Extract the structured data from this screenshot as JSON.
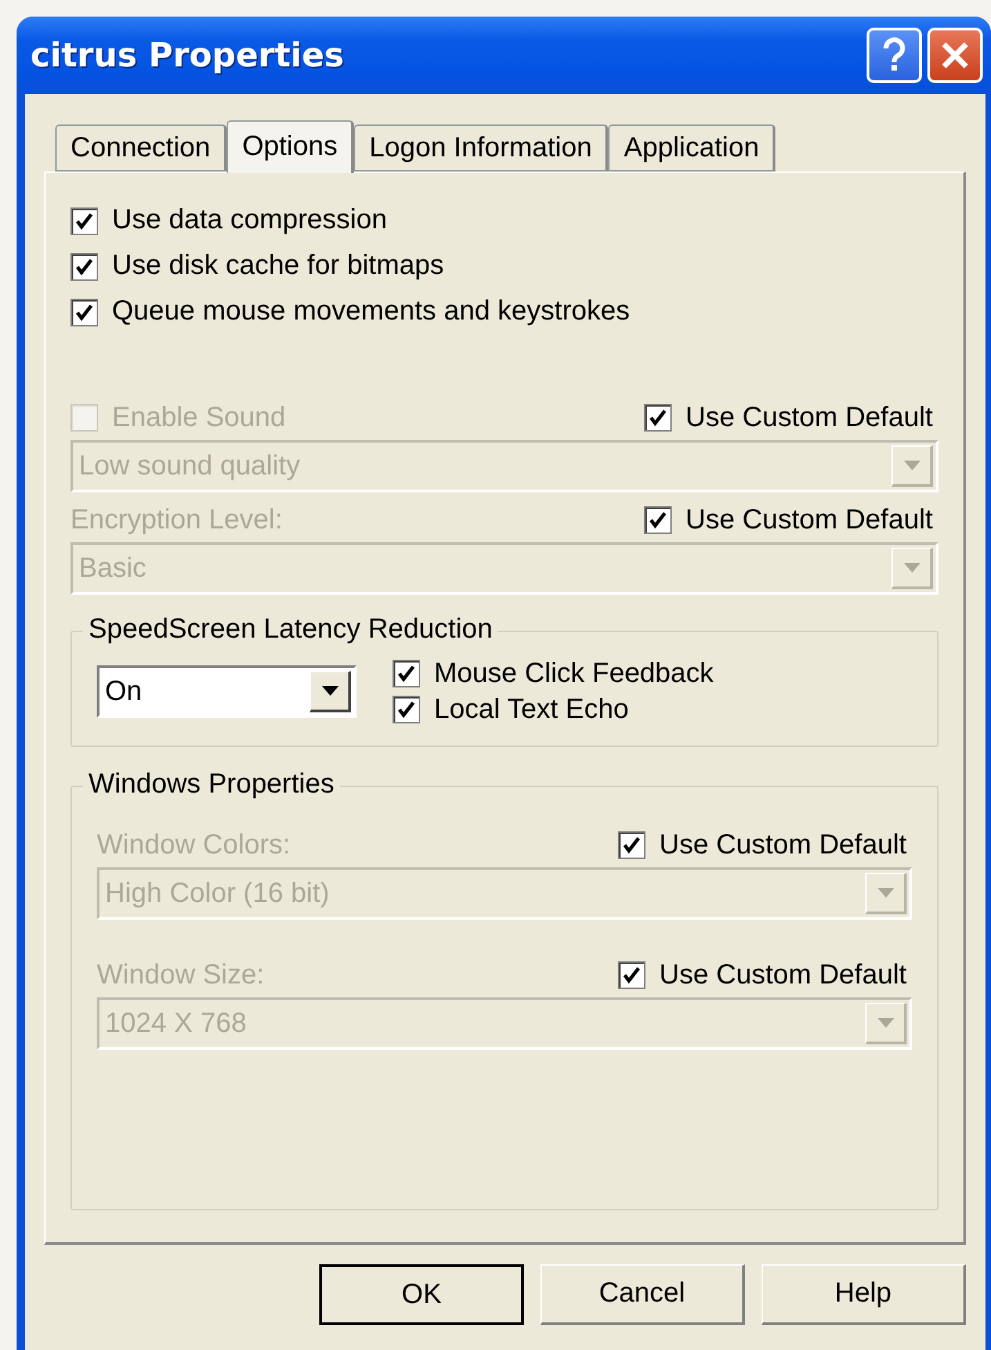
{
  "window": {
    "title": "citrus Properties"
  },
  "tabs": [
    {
      "label": "Connection",
      "selected": false
    },
    {
      "label": "Options",
      "selected": true
    },
    {
      "label": "Logon Information",
      "selected": false
    },
    {
      "label": "Application",
      "selected": false
    }
  ],
  "options": [
    {
      "label": "Use data compression",
      "checked": true
    },
    {
      "label": "Use disk cache for bitmaps",
      "checked": true
    },
    {
      "label": "Queue mouse movements and keystrokes",
      "checked": true
    }
  ],
  "settings": [
    {
      "kind": "checkbox",
      "label": "Enable Sound",
      "checked": false,
      "disabled": true,
      "custom_default": {
        "label": "Use Custom Default",
        "checked": true
      },
      "dropdown": {
        "value": "Low sound quality",
        "disabled": true
      }
    },
    {
      "kind": "label",
      "label": "Encryption Level:",
      "disabled": true,
      "custom_default": {
        "label": "Use Custom Default",
        "checked": true
      },
      "dropdown": {
        "value": "Basic",
        "disabled": true
      }
    }
  ],
  "speedscreen": {
    "title": "SpeedScreen Latency Reduction",
    "dropdown": {
      "value": "On",
      "disabled": false
    },
    "checkboxes": [
      {
        "label": "Mouse Click Feedback",
        "checked": true
      },
      {
        "label": "Local Text Echo",
        "checked": true
      }
    ]
  },
  "windows_properties": {
    "title": "Windows Properties",
    "settings": [
      {
        "kind": "label",
        "label": "Window Colors:",
        "disabled": true,
        "custom_default": {
          "label": "Use Custom Default",
          "checked": true
        },
        "dropdown": {
          "value": "High Color (16 bit)",
          "disabled": true
        }
      },
      {
        "kind": "label",
        "label": "Window Size:",
        "disabled": true,
        "custom_default": {
          "label": "Use Custom Default",
          "checked": true
        },
        "dropdown": {
          "value": "1024 X 768",
          "disabled": true
        }
      }
    ]
  },
  "buttons": [
    {
      "label": "OK",
      "default": true
    },
    {
      "label": "Cancel",
      "default": false
    },
    {
      "label": "Help",
      "default": false
    }
  ]
}
